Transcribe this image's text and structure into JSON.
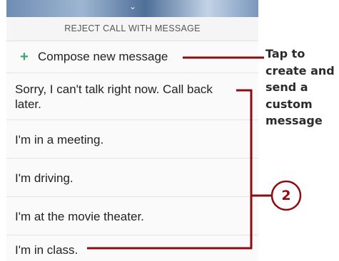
{
  "dialog": {
    "title": "REJECT CALL WITH MESSAGE",
    "compose_label": "Compose new message",
    "compose_icon": "plus-icon"
  },
  "messages": [
    "Sorry, I can't talk right now. Call back later.",
    "I'm in a meeting.",
    "I'm driving.",
    "I'm at the movie theater.",
    "I'm in class."
  ],
  "callout": {
    "text": "Tap to create and send a custom message",
    "step_number": "2"
  },
  "colors": {
    "callout_line": "#8b0d12",
    "compose_plus": "#3ba86e"
  }
}
